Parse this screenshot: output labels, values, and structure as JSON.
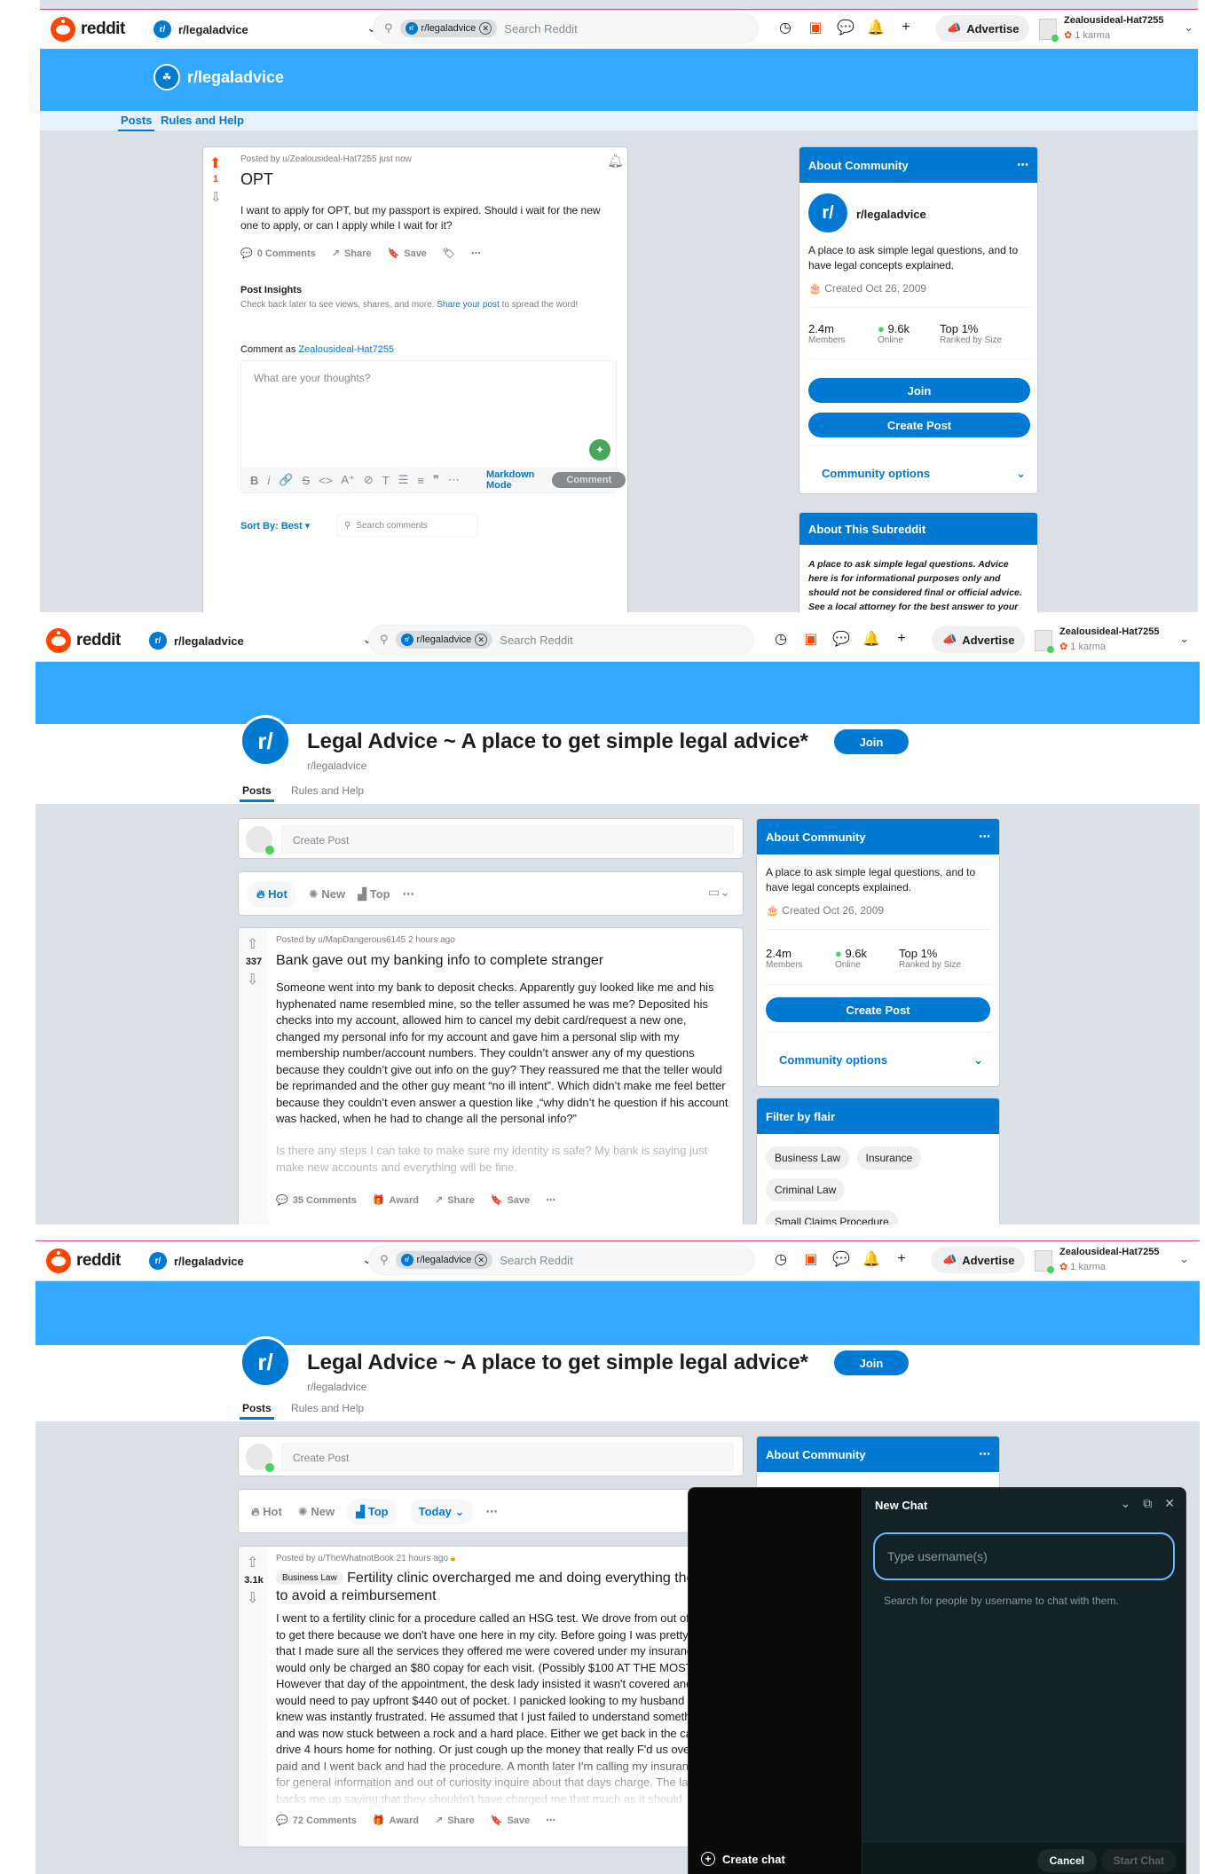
{
  "top_nav": {
    "logo_text": "reddit",
    "community": "r/legaladvice",
    "search_chip": "r/legaladvice",
    "search_placeholder": "Search Reddit",
    "advertise": "Advertise",
    "username": "Zealousideal-Hat7255",
    "karma": "1 karma"
  },
  "p1": {
    "header_name": "r/legaladvice",
    "tabs": [
      "Posts",
      "Rules and Help"
    ],
    "post": {
      "meta": "Posted by u/Zealousideal-Hat7255 just now",
      "score": "1",
      "title": "OPT",
      "body": "I want to apply for OPT, but my passport is expired. Should i wait for the new one to apply, or can I apply while I wait for it?",
      "comments": "0 Comments",
      "share": "Share",
      "save": "Save",
      "insights_title": "Post Insights",
      "insights_text": "Check back later to see views, shares, and more.",
      "insights_link": "Share your post",
      "insights_tail": "to spread the word!",
      "comment_as": "Comment as",
      "comment_as_user": "Zealousideal-Hat7255",
      "comment_placeholder": "What are your thoughts?",
      "markdown_mode": "Markdown Mode",
      "comment_btn": "Comment",
      "sort_by": "Sort By: Best",
      "search_comments": "Search comments"
    },
    "about_this": {
      "title": "About This Subreddit",
      "text": "A place to ask simple legal questions. Advice here is for informational purposes only and should not be considered final or official advice. See a local attorney for the best answer to your questions."
    }
  },
  "about": {
    "title": "About Community",
    "name": "r/legaladvice",
    "description": "A place to ask simple legal questions, and to have legal concepts explained.",
    "created": "Created Oct 26, 2009",
    "members_value": "2.4m",
    "members_label": "Members",
    "online_value": "9.6k",
    "online_label": "Online",
    "rank_value": "Top 1%",
    "rank_label": "Ranked by Size",
    "join": "Join",
    "create_post": "Create Post",
    "community_options": "Community options"
  },
  "p2": {
    "title": "Legal Advice ~ A place to get simple legal advice*",
    "subname": "r/legaladvice",
    "join": "Join",
    "tabs": [
      "Posts",
      "Rules and Help"
    ],
    "create_post_placeholder": "Create Post",
    "sort": [
      "Hot",
      "New",
      "Top"
    ],
    "post": {
      "meta": "Posted by u/MapDangerous6145 2 hours ago",
      "score": "337",
      "title": "Bank gave out my banking info to complete stranger",
      "body": "Someone went into my bank to deposit checks. Apparently guy looked like me and his hyphenated name resembled mine, so the teller assumed he was me? Deposited his checks into my account, allowed him to cancel my debit card/request a new one, changed my personal info for my account and gave him a personal slip with my membership number/account numbers. They couldn’t answer any of my questions because they couldn’t give out info on the guy? They reassured me that the teller would be reprimanded and the other guy meant “no ill intent”. Which didn’t make me feel better because they couldn’t even answer a question like ,“why didn’t he question if his account was hacked, when he had to change all the personal info?”",
      "body_fade": "Is there any steps I can take to make sure my identity is safe? My bank is saying just make new accounts and everything will be fine.",
      "comments": "35 Comments",
      "award": "Award",
      "share": "Share",
      "save": "Save"
    },
    "flair": {
      "title": "Filter by flair",
      "items": [
        "Business Law",
        "Insurance",
        "Criminal Law",
        "Small Claims Procedure"
      ]
    }
  },
  "p3": {
    "sort": [
      "Hot",
      "New",
      "Top"
    ],
    "today": "Today",
    "post": {
      "meta": "Posted by u/TheWhatnotBook 21 hours ago",
      "score": "3.1k",
      "flair": "Business Law",
      "title": "Fertility clinic overcharged me and doing everything they can to avoid a reimbursement",
      "body": "I went to a fertility clinic for a procedure called an HSG test. We drove from out of state to get there because we don't have one here in my city. Before going I was pretty certain that I made sure all the services they offered me were covered under my insurance and I would only be charged an $80 copay for each visit. (Possibly $100 AT THE MOST) However that day of the appointment, the desk lady insisted it wasn't covered and I would need to pay upfront $440 out of pocket. I panicked looking to my husband who I knew was instantly frustrated. He assumed that I just failed to understand something and was now stuck between a rock and a hard place. Either we get back in the car and drive 4 hours home for nothing. Or just cough up the money that really F'd us over. We paid and I went back and had the procedure. A month later I'm calling my insurance just for general information and out of curiosity inquire about that days charge. The lady backs me up saying that they shouldn't have charged me that much as it should",
      "comments": "72 Comments",
      "award": "Award",
      "share": "Share",
      "save": "Save"
    },
    "chat": {
      "title": "New Chat",
      "input_placeholder": "Type username(s)",
      "hint": "Search for people by username to chat with them.",
      "create_chat": "Create chat",
      "cancel": "Cancel",
      "start_chat": "Start Chat"
    }
  },
  "colors": {
    "brand": "#ff4500",
    "accent": "#0079d3",
    "banner": "#33a8ff",
    "online": "#46d160"
  }
}
